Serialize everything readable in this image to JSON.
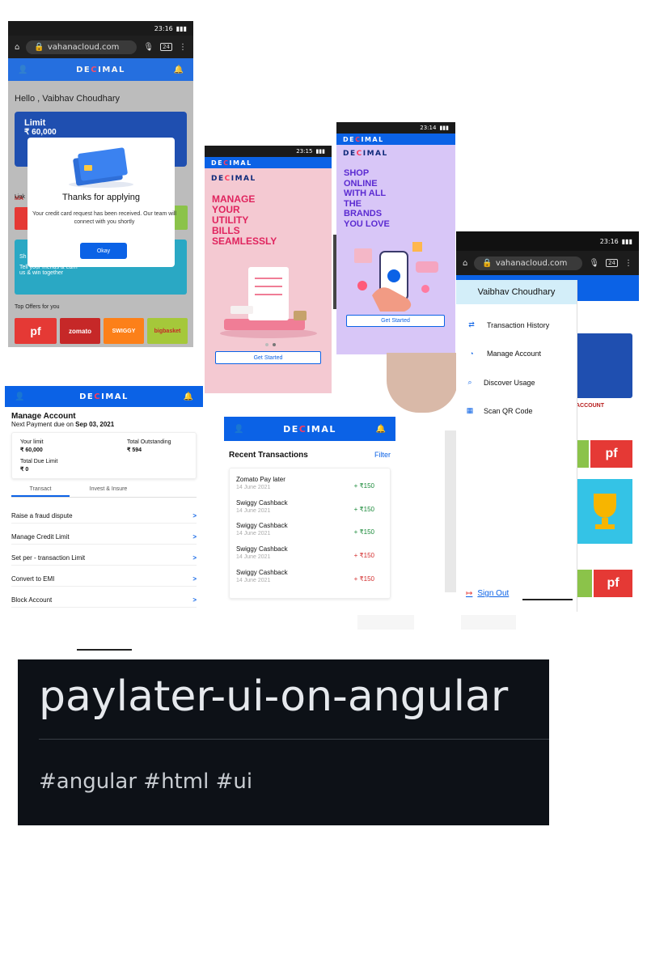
{
  "browser": {
    "time": "23:16",
    "url": "vahanacloud.com",
    "tabs_count": "24"
  },
  "brand": {
    "logo_pre": "DE",
    "logo_c": "C",
    "logo_post": "IMAL"
  },
  "home_screen": {
    "greeting": "Hello , Vaibhav Choudhary",
    "limit_label": "Limit",
    "limit_value": "₹ 60,000",
    "link_label": "Link",
    "dialog_title": "Thanks for applying",
    "dialog_message": "Your credit card request has been received. Our team will connect with you shortly",
    "ok_button": "Okay",
    "promo_line1": "Sh",
    "promo_line2": "Tell your friends & earn",
    "promo_line3": "us & win together",
    "top_offers": "Top Offers for you",
    "offers": [
      "pf",
      "zomato",
      "SWIGGY",
      "bigbasket"
    ]
  },
  "onboarding_utility": {
    "time": "23:15",
    "title_lines": [
      "MANAGE",
      "YOUR",
      "UTILITY",
      "BILLS",
      "SEAMLESSLY"
    ],
    "cta": "Get Started"
  },
  "onboarding_shop": {
    "time": "23:14",
    "title_lines": [
      "SHOP",
      "ONLINE",
      "WITH ALL",
      "THE",
      "BRANDS",
      "YOU LOVE"
    ],
    "cta": "Get Started"
  },
  "drawer": {
    "user_name": "Vaibhav Choudhary",
    "items": [
      "Transaction History",
      "Manage Account",
      "Discover Usage",
      "Scan QR Code"
    ],
    "sign_out": "Sign Out",
    "behind_text": "ACCOUNT",
    "behind_offer": "pf"
  },
  "manage_account": {
    "title": "Manage Account",
    "next_payment_label": "Next Payment due on",
    "next_payment_date": "Sep 03, 2021",
    "your_limit_label": "Your limit",
    "your_limit_value": "₹ 60,000",
    "total_outstanding_label": "Total Outstanding",
    "total_outstanding_value": "₹ 594",
    "total_due_label": "Total Due Limit",
    "total_due_value": "₹ 0",
    "tabs": [
      "Transact",
      "Invest & Insure"
    ],
    "items": [
      "Raise a fraud dispute",
      "Manage Credit Limit",
      "Set per - transaction Limit",
      "Convert to EMI",
      "Block Account"
    ]
  },
  "transactions": {
    "title": "Recent Transactions",
    "filter": "Filter",
    "rows": [
      {
        "name": "Zomato Pay later",
        "date": "14 June 2021",
        "amount": "+ ₹150",
        "color": "#1b8a3a"
      },
      {
        "name": "Swiggy Cashback",
        "date": "14 June 2021",
        "amount": "+ ₹150",
        "color": "#1b8a3a"
      },
      {
        "name": "Swiggy Cashback",
        "date": "14 June 2021",
        "amount": "+ ₹150",
        "color": "#1b8a3a"
      },
      {
        "name": "Swiggy Cashback",
        "date": "14 June 2021",
        "amount": "+ ₹150",
        "color": "#d32f2f"
      },
      {
        "name": "Swiggy Cashback",
        "date": "14 June 2021",
        "amount": "+ ₹150",
        "color": "#d32f2f"
      }
    ]
  },
  "banner": {
    "title": "paylater-ui-on-angular",
    "tags": "#angular #html #ui"
  },
  "colors": {
    "primary": "#0b62e6",
    "accent": "#ff3b5c",
    "pink_bg": "#f4c9d2",
    "purple_bg": "#d8c6f7"
  }
}
